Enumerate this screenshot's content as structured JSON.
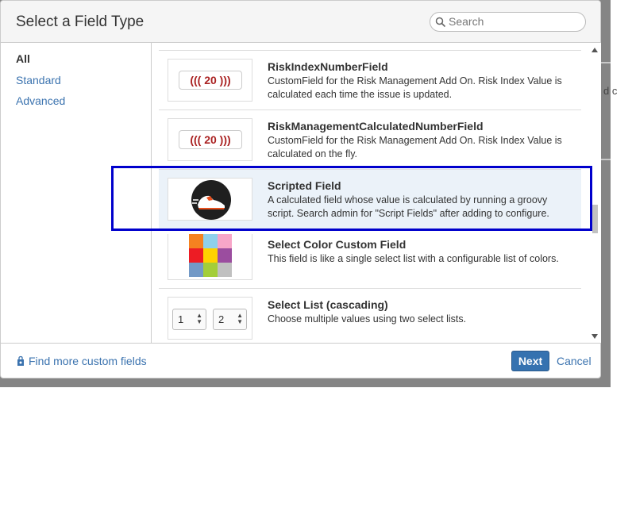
{
  "dialog": {
    "title": "Select a Field Type",
    "search_placeholder": "Search"
  },
  "sidebar": {
    "items": [
      {
        "label": "All",
        "active": true
      },
      {
        "label": "Standard",
        "active": false
      },
      {
        "label": "Advanced",
        "active": false
      }
    ]
  },
  "fields": [
    {
      "name": "RiskIndexNumberField",
      "description": "CustomField for the Risk Management Add On. Risk Index Value is calculated each time the issue is updated.",
      "preview": "((( 20 )))"
    },
    {
      "name": "RiskManagementCalculatedNumberField",
      "description": "CustomField for the Risk Management Add On. Risk Index Value is calculated on the fly.",
      "preview": "((( 20 )))"
    },
    {
      "name": "Scripted Field",
      "description": "A calculated field whose value is calculated by running a groovy script. Search admin for \"Script Fields\" after adding to configure.",
      "selected": true
    },
    {
      "name": "Select Color Custom Field",
      "description": "This field is like a single select list with a configurable list of colors.",
      "colors": [
        "#f58220",
        "#8fd1ec",
        "#f7a6c8",
        "#ed1c24",
        "#ffd200",
        "#9b4d9f",
        "#7399c6",
        "#a3ce39",
        "#c0c0c0"
      ]
    },
    {
      "name": "Select List (cascading)",
      "description": "Choose multiple values using two select lists.",
      "preview_values": [
        "1",
        "2"
      ]
    }
  ],
  "footer": {
    "find_more": "Find more custom fields",
    "next_label": "Next",
    "cancel_label": "Cancel"
  },
  "background": {
    "partial_text": "d c"
  }
}
